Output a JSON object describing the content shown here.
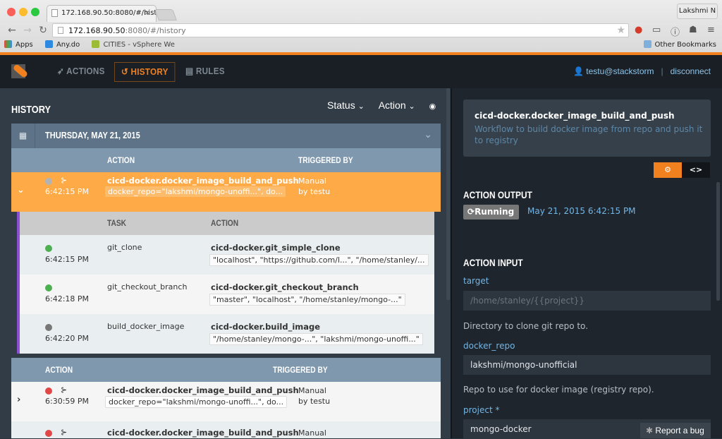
{
  "browser": {
    "tab_title": "172.168.90.50:8080/#/histo",
    "profile": "Lakshmi N",
    "url_host": "172.168.90.50",
    "url_rest": ":8080/#/history",
    "bookmarks": [
      "Apps",
      "Any.do",
      "CITIES - vSphere We"
    ],
    "other_bookmarks": "Other Bookmarks"
  },
  "nav": {
    "items": [
      {
        "label": "ACTIONS",
        "icon": "rocket-icon"
      },
      {
        "label": "HISTORY",
        "icon": "history-icon",
        "active": true
      },
      {
        "label": "RULES",
        "icon": "book-icon"
      }
    ],
    "user": "testu@stackstorm",
    "sep": "|",
    "disconnect": "disconnect"
  },
  "history": {
    "title": "HISTORY",
    "filters": {
      "status": "Status",
      "action": "Action"
    },
    "date": "THURSDAY, MAY 21, 2015",
    "columns": {
      "action": "ACTION",
      "triggered_by": "TRIGGERED BY"
    },
    "selected": {
      "time": "6:42:15 PM",
      "action": "cicd-docker.docker_image_build_and_push",
      "params": "docker_repo=\"lakshmi/mongo-unoffi...\", do...",
      "trigger1": "Manual",
      "trigger2": "by testu"
    },
    "sub_columns": {
      "task": "TASK",
      "action": "ACTION"
    },
    "subtasks": [
      {
        "time": "6:42:15 PM",
        "task": "git_clone",
        "action": "cicd-docker.git_simple_clone",
        "params": "\"localhost\", \"https://github.com/l...\", \"/home/stanley/...",
        "status": "succeeded"
      },
      {
        "time": "6:42:18 PM",
        "task": "git_checkout_branch",
        "action": "cicd-docker.git_checkout_branch",
        "params": "\"master\", \"localhost\", \"/home/stanley/mongo-...\"",
        "status": "succeeded"
      },
      {
        "time": "6:42:20 PM",
        "task": "build_docker_image",
        "action": "cicd-docker.build_image",
        "params": "\"/home/stanley/mongo-...\", \"lakshmi/mongo-unoffi...\"",
        "status": "running"
      }
    ],
    "columns2": {
      "action": "ACTION",
      "triggered_by": "TRIGGERED BY"
    },
    "rows": [
      {
        "time": "6:30:59 PM",
        "action": "cicd-docker.docker_image_build_and_push",
        "params": "docker_repo=\"lakshmi/mongo-unoffi...\", do...",
        "trigger1": "Manual",
        "trigger2": "by testu",
        "status": "failed"
      },
      {
        "time": "",
        "action": "cicd-docker.docker_image_build_and_push",
        "params": "",
        "trigger1": "Manual",
        "trigger2": "",
        "status": "failed"
      }
    ]
  },
  "details": {
    "name": "cicd-docker.docker_image_build_and_push",
    "description": "Workflow to build docker image from repo and push it to registry",
    "output_title": "ACTION OUTPUT",
    "status": "Running",
    "started": "May 21, 2015 6:42:15 PM",
    "input_title": "ACTION INPUT",
    "fields": [
      {
        "label": "target",
        "value": "/home/stanley/{{project}}",
        "placeholder": true,
        "help": "Directory to clone git repo to."
      },
      {
        "label": "docker_repo",
        "value": "lakshmi/mongo-unofficial",
        "help": "Repo to use for docker image (registry repo)."
      },
      {
        "label": "project *",
        "value": "mongo-docker"
      }
    ],
    "report_bug": "Report a bug"
  },
  "colors": {
    "accent": "#f0811e",
    "selected_row": "#fdaa47",
    "success": "#4caf50",
    "failed": "#e04848",
    "running": "#777777",
    "link": "#73b6e6"
  }
}
